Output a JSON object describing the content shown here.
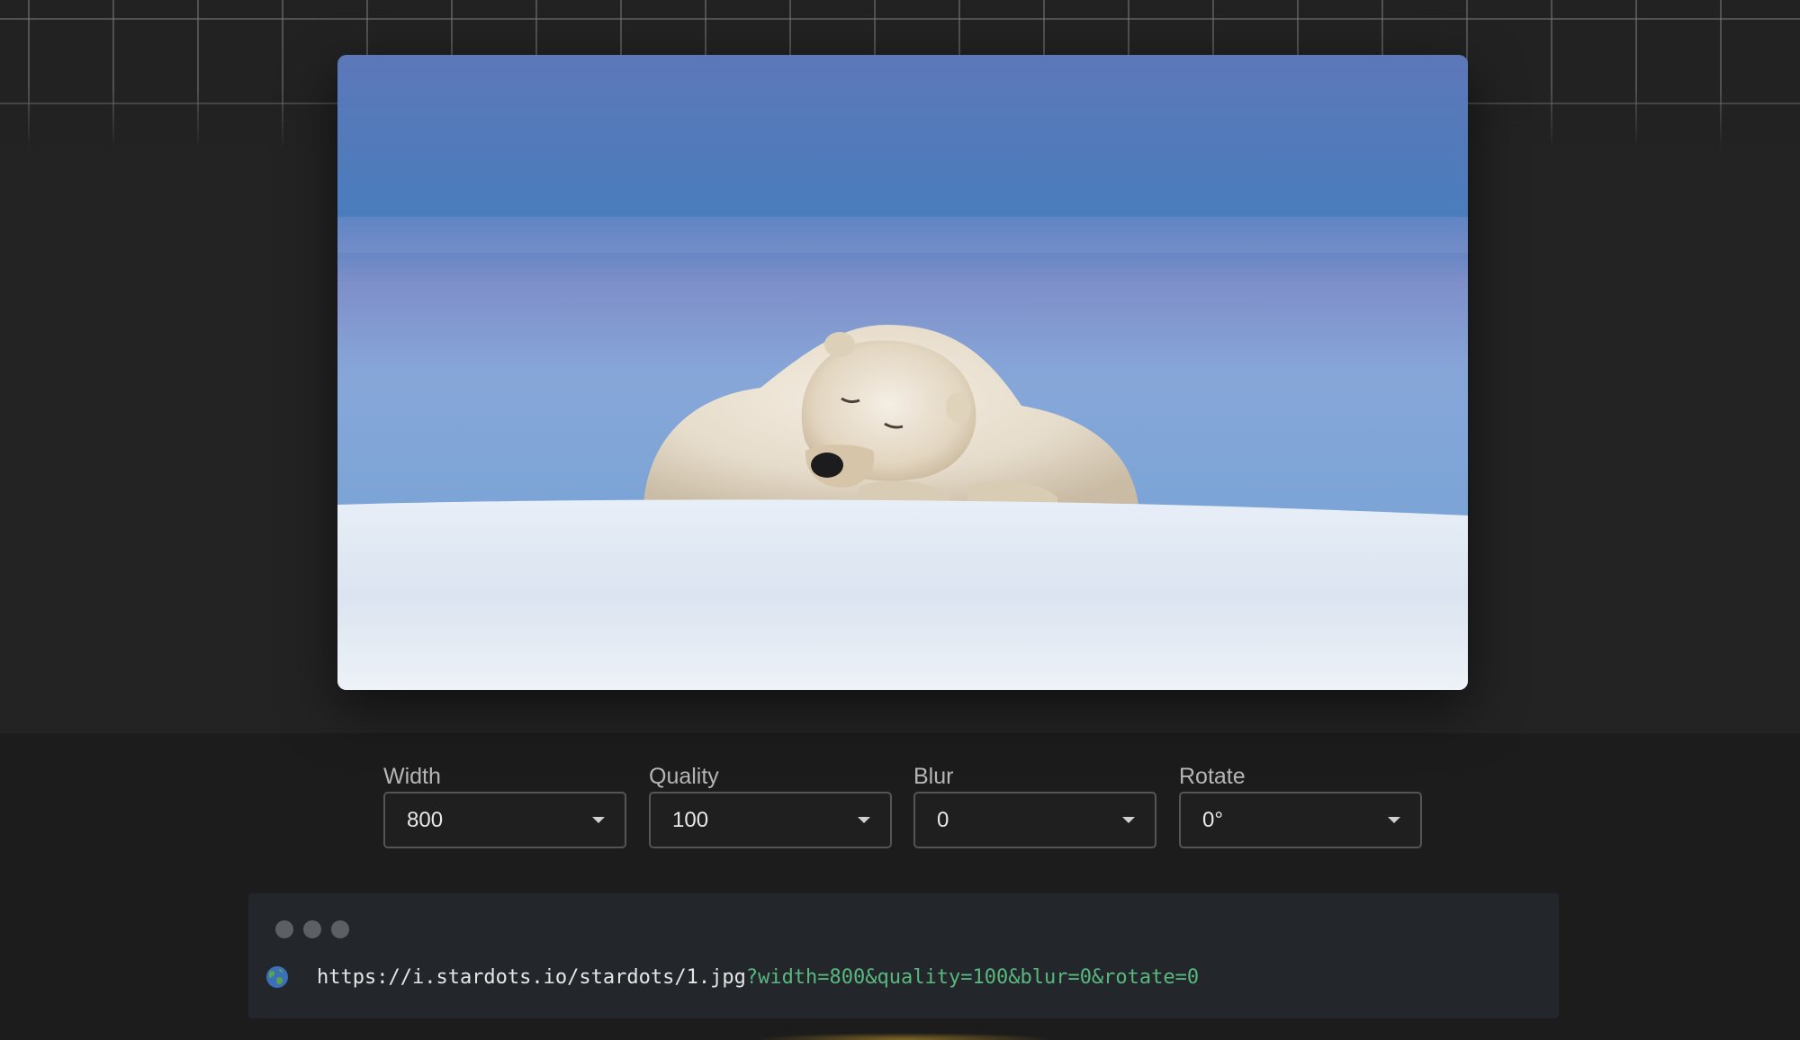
{
  "image": {
    "alt": "Polar bear sleeping on snow"
  },
  "controls": [
    {
      "label": "Width",
      "value": "800"
    },
    {
      "label": "Quality",
      "value": "100"
    },
    {
      "label": "Blur",
      "value": "0"
    },
    {
      "label": "Rotate",
      "value": "0°"
    }
  ],
  "url": {
    "base": "https://i.stardots.io/stardots/1.jpg",
    "query": "?width=800&quality=100&blur=0&rotate=0"
  },
  "colors": {
    "background": "#1d1d1d",
    "select_border": "#555555",
    "url_panel": "#23272c",
    "url_query": "#59b87d"
  },
  "icons": {
    "globe": "globe-icon",
    "caret": "chevron-down-icon"
  }
}
